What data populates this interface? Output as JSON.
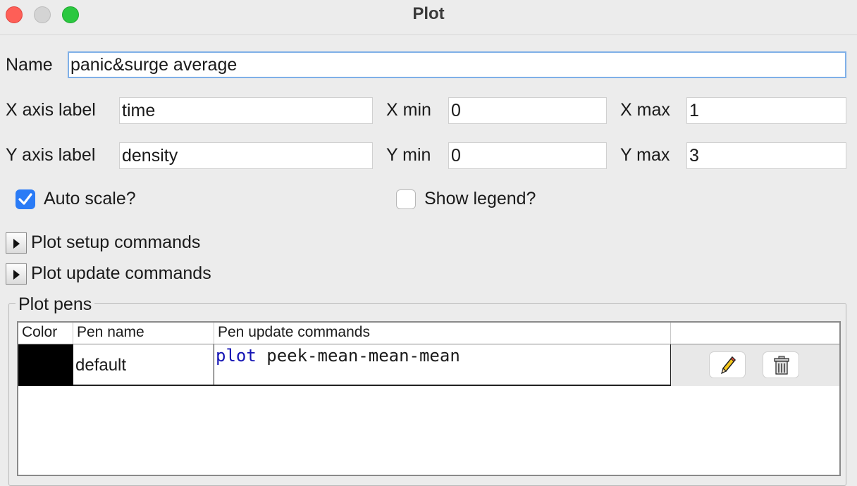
{
  "window": {
    "title": "Plot"
  },
  "form": {
    "name_label": "Name",
    "name_value": "panic&surge average",
    "x_axis_label": "X axis label",
    "x_axis_value": "time",
    "x_min_label": "X min",
    "x_min_value": "0",
    "x_max_label": "X max",
    "x_max_value": "1",
    "y_axis_label": "Y axis label",
    "y_axis_value": "density",
    "y_min_label": "Y min",
    "y_min_value": "0",
    "y_max_label": "Y max",
    "y_max_value": "3",
    "auto_scale_label": "Auto scale?",
    "auto_scale_checked": true,
    "show_legend_label": "Show legend?",
    "show_legend_checked": false
  },
  "sections": {
    "setup_label": "Plot setup commands",
    "update_label": "Plot update commands"
  },
  "pens": {
    "group_title": "Plot pens",
    "headers": {
      "color": "Color",
      "name": "Pen name",
      "commands": "Pen update commands"
    },
    "rows": [
      {
        "color": "#000000",
        "name": "default",
        "command_keyword": "plot",
        "command_rest": " peek-mean-mean-mean",
        "edit_icon": "pencil-icon",
        "delete_icon": "trash-icon"
      }
    ]
  }
}
